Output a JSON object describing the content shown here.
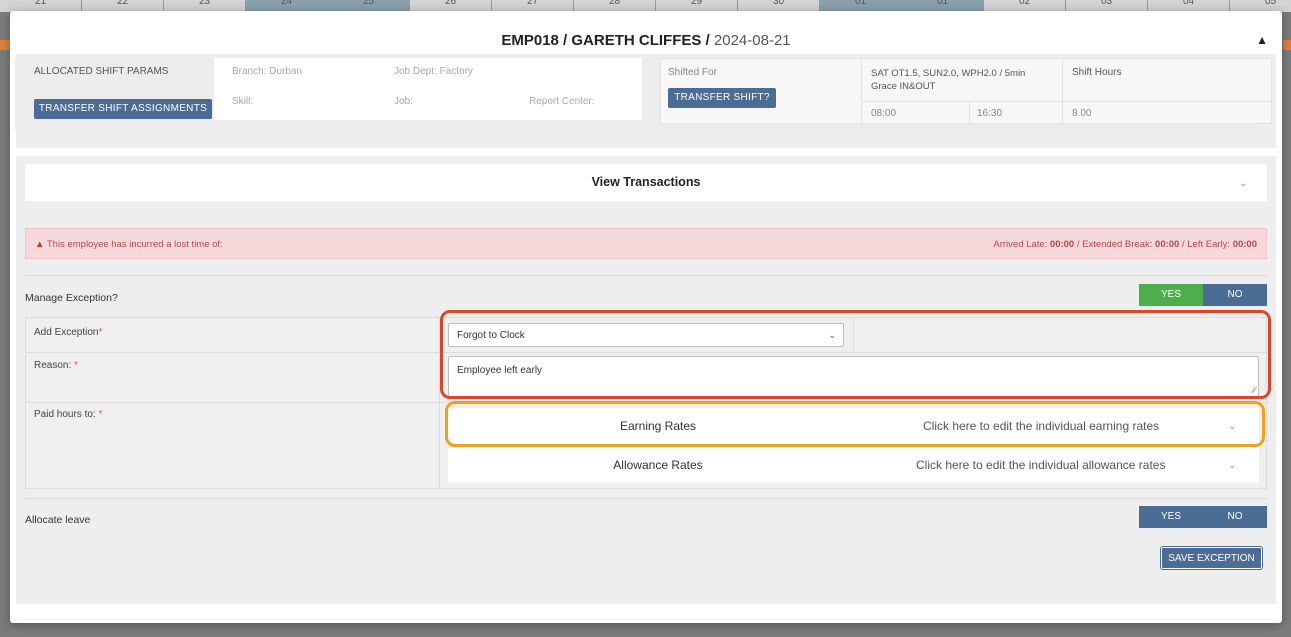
{
  "background": {
    "calendar_days": [
      "21",
      "22",
      "23",
      "24",
      "25",
      "26",
      "27",
      "28",
      "29",
      "30",
      "01",
      "01",
      "02",
      "03",
      "04",
      "05"
    ]
  },
  "modal": {
    "employee": "EMP018 / GARETH CLIFFES /",
    "date": "2024-08-21",
    "alert_icon": "warning-icon"
  },
  "shift_params": {
    "allocated_label": "ALLOCATED SHIFT PARAMS",
    "transfer_assignments_btn": "TRANSFER SHIFT ASSIGNMENTS",
    "branch": "Branch: Durban",
    "job_dept": "Job Dept: Factory",
    "skill": "Skill:",
    "job": "Job:",
    "report_center": "Report Center:",
    "shifted_for": "Shifted For",
    "transfer_shift_btn": "TRANSFER SHIFT?",
    "shift_name": "SAT OT1.5, SUN2.0, WPH2.0 / 5min Grace IN&OUT",
    "start_time": "08:00",
    "end_time": "16:30",
    "shift_hours_label": "Shift Hours",
    "shift_hours": "8.00"
  },
  "transactions": {
    "title": "View Transactions"
  },
  "alert": {
    "message": "This employee has incurred a lost time of:",
    "arrived_late_label": "Arrived Late:",
    "arrived_late": "00:00",
    "extended_break_label": "Extended Break:",
    "extended_break": "00:00",
    "left_early_label": "Left Early:",
    "left_early": "00:00"
  },
  "manage_exception": {
    "label": "Manage Exception?",
    "yes": "YES",
    "no": "NO"
  },
  "exception_form": {
    "add_exception_label": "Add Exception",
    "exception_value": "Forgot to Clock",
    "reason_label": "Reason:",
    "reason_value": "Employee left early",
    "paid_hours_label": "Paid hours to:",
    "required_mark": "*",
    "earning_rates": "Earning Rates",
    "earning_rates_hint": "Click here to edit the individual earning rates",
    "allowance_rates": "Allowance Rates",
    "allowance_rates_hint": "Click here to edit the individual allowance rates"
  },
  "allocate_leave": {
    "label": "Allocate leave",
    "yes": "YES",
    "no": "NO"
  },
  "save_button": "SAVE EXCEPTION",
  "colors": {
    "primary": "#4a6c95",
    "yes_active": "#4cae4c",
    "alert_bg": "#f7d9dc",
    "highlight_red": "#d9472b",
    "highlight_orange": "#f0a01f"
  }
}
